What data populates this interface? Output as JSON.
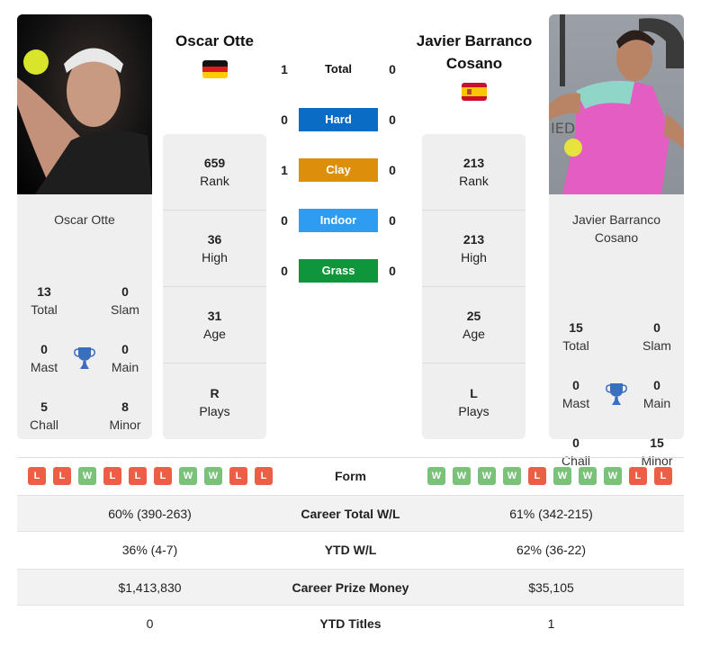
{
  "player1": {
    "name": "Oscar Otte",
    "card_name": "Oscar Otte",
    "flag": "germany",
    "photo_alt": "Oscar Otte photo",
    "titles": {
      "total": {
        "value": "13",
        "label": "Total"
      },
      "slam": {
        "value": "0",
        "label": "Slam"
      },
      "mast": {
        "value": "0",
        "label": "Mast"
      },
      "main": {
        "value": "0",
        "label": "Main"
      },
      "chall": {
        "value": "5",
        "label": "Chall"
      },
      "minor": {
        "value": "8",
        "label": "Minor"
      }
    },
    "stats": [
      {
        "value": "659",
        "label": "Rank"
      },
      {
        "value": "36",
        "label": "High"
      },
      {
        "value": "31",
        "label": "Age"
      },
      {
        "value": "R",
        "label": "Plays"
      }
    ],
    "form": [
      "L",
      "L",
      "W",
      "L",
      "L",
      "L",
      "W",
      "W",
      "L",
      "L"
    ]
  },
  "player2": {
    "name": "Javier Barranco Cosano",
    "card_name": "Javier Barranco Cosano",
    "flag": "spain",
    "photo_alt": "Javier Barranco Cosano photo",
    "titles": {
      "total": {
        "value": "15",
        "label": "Total"
      },
      "slam": {
        "value": "0",
        "label": "Slam"
      },
      "mast": {
        "value": "0",
        "label": "Mast"
      },
      "main": {
        "value": "0",
        "label": "Main"
      },
      "chall": {
        "value": "0",
        "label": "Chall"
      },
      "minor": {
        "value": "15",
        "label": "Minor"
      }
    },
    "stats": [
      {
        "value": "213",
        "label": "Rank"
      },
      {
        "value": "213",
        "label": "High"
      },
      {
        "value": "25",
        "label": "Age"
      },
      {
        "value": "L",
        "label": "Plays"
      }
    ],
    "form": [
      "W",
      "W",
      "W",
      "W",
      "L",
      "W",
      "W",
      "W",
      "L",
      "L"
    ]
  },
  "h2h": [
    {
      "label": "Total",
      "p1": "1",
      "p2": "0",
      "color": ""
    },
    {
      "label": "Hard",
      "p1": "0",
      "p2": "0",
      "color": "#0a6cc4"
    },
    {
      "label": "Clay",
      "p1": "1",
      "p2": "0",
      "color": "#dd8f0b"
    },
    {
      "label": "Indoor",
      "p1": "0",
      "p2": "0",
      "color": "#2e9cf0"
    },
    {
      "label": "Grass",
      "p1": "0",
      "p2": "0",
      "color": "#0f963a"
    }
  ],
  "form_label": "Form",
  "comparison": [
    {
      "label": "Career Total W/L",
      "p1": "60% (390-263)",
      "p2": "61% (342-215)"
    },
    {
      "label": "YTD W/L",
      "p1": "36% (4-7)",
      "p2": "62% (36-22)"
    },
    {
      "label": "Career Prize Money",
      "p1": "$1,413,830",
      "p2": "$35,105"
    },
    {
      "label": "YTD Titles",
      "p1": "0",
      "p2": "1"
    }
  ],
  "colors": {
    "win": "#7ac17a",
    "loss": "#ec5e45",
    "trophy": "#3a6fc0"
  }
}
